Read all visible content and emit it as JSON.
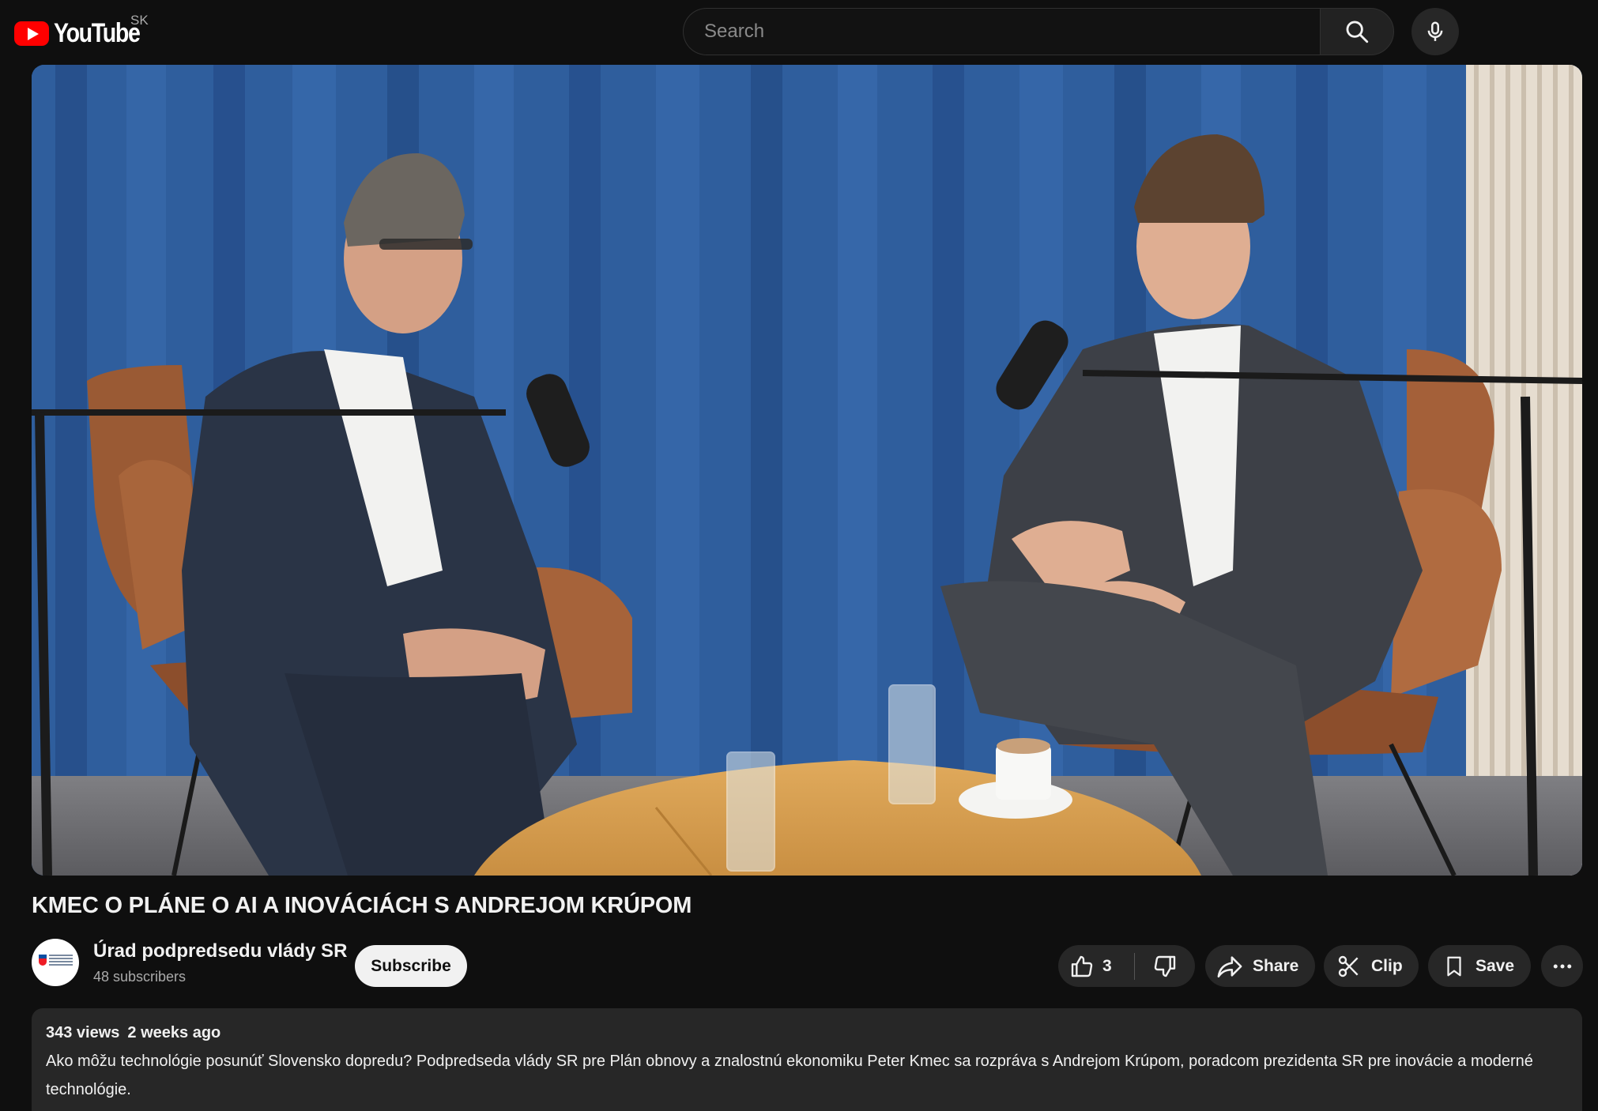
{
  "header": {
    "logo_text": "YouTube",
    "country": "SK",
    "search_placeholder": "Search"
  },
  "video": {
    "title": "KMEC O PLÁNE O AI A INOVÁCIÁCH S ANDREJOM KRÚPOM"
  },
  "channel": {
    "name": "Úrad podpredsedu vlády SR",
    "subscribers": "48 subscribers",
    "subscribe_label": "Subscribe"
  },
  "actions": {
    "like_count": "3",
    "share_label": "Share",
    "clip_label": "Clip",
    "save_label": "Save"
  },
  "description": {
    "views": "343 views",
    "age": "2 weeks ago",
    "text": "Ako môžu technológie posunúť Slovensko dopredu? Podpredseda vlády SR pre Plán obnovy a znalostnú ekonomiku Peter Kmec sa rozpráva s Andrejom Krúpom, poradcom prezidenta SR pre inovácie a moderné technológie."
  },
  "icons": {
    "search": "search-icon",
    "mic": "microphone-icon",
    "like": "thumbs-up-icon",
    "dislike": "thumbs-down-icon",
    "share": "share-arrow-icon",
    "clip": "scissors-icon",
    "save": "bookmark-icon",
    "more": "more-horizontal-icon"
  },
  "colors": {
    "background": "#0f0f0f",
    "brand_red": "#ff0000",
    "pill": "#272727"
  }
}
